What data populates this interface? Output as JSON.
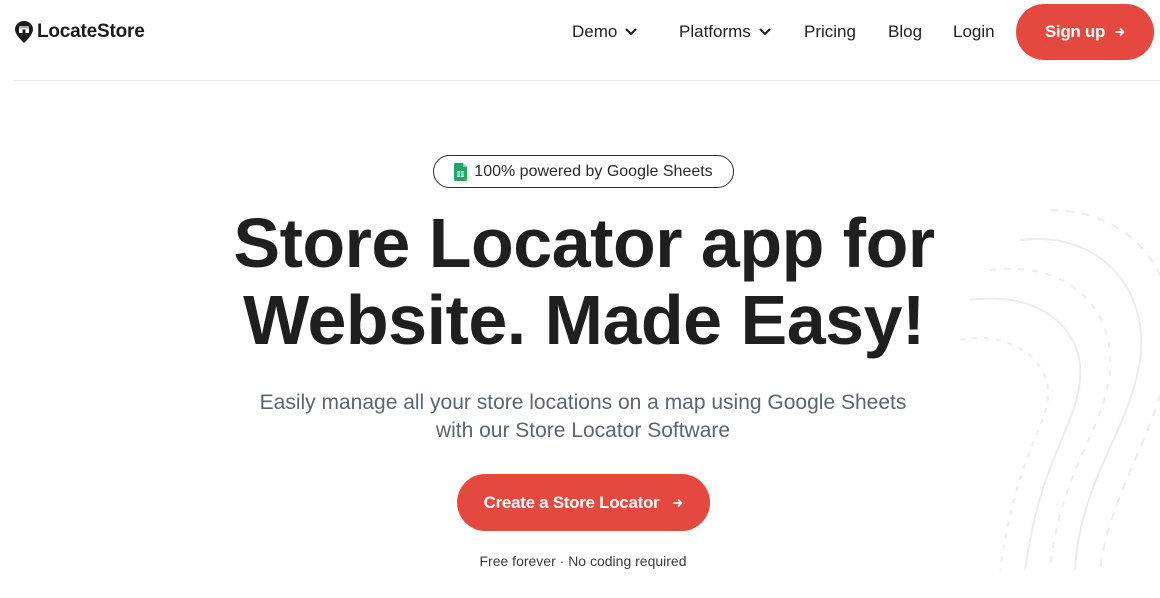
{
  "brand": {
    "name": "LocateStore"
  },
  "nav": {
    "demo": "Demo",
    "platforms": "Platforms",
    "pricing": "Pricing",
    "blog": "Blog",
    "login": "Login",
    "signup": "Sign up"
  },
  "hero": {
    "badge": "100% powered by Google Sheets",
    "title_line1": "Store Locator app for",
    "title_line2": "Website. Made Easy!",
    "subtitle_line1": "Easily manage all your store locations on a map using Google Sheets",
    "subtitle_line2": "with our Store Locator Software",
    "cta": "Create a Store Locator",
    "note": "Free forever · No coding required"
  },
  "colors": {
    "accent": "#e5483f",
    "text": "#1f1f1f",
    "muted": "#5b6472",
    "sheets_green": "#23a566"
  },
  "icons": {
    "logo": "map-pin-store-icon",
    "dropdown": "chevron-down-icon",
    "arrow": "arrow-right-icon",
    "sheets": "google-sheets-icon"
  }
}
